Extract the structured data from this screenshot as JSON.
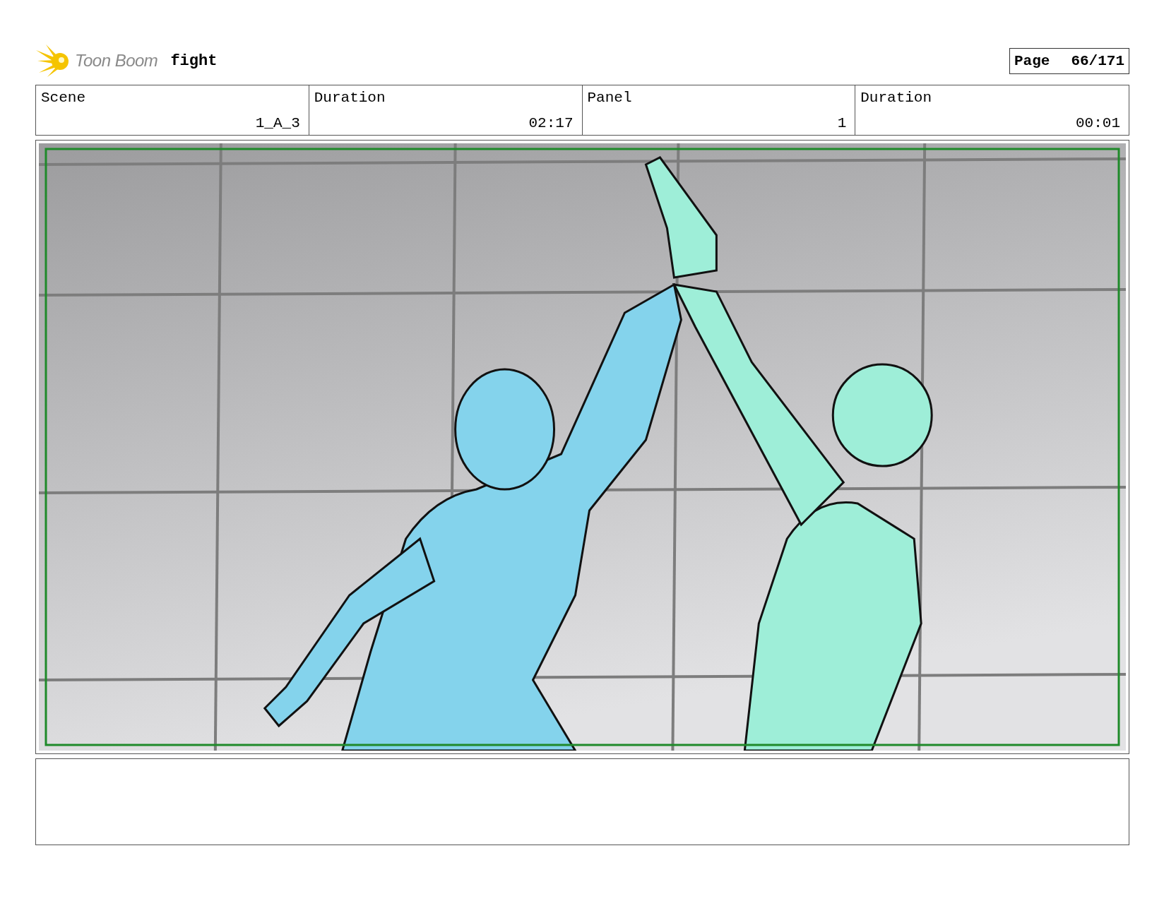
{
  "header": {
    "logo": "Toon Boom",
    "title": "fight",
    "page_label": "Page",
    "page_number": "66/171"
  },
  "info": [
    {
      "label": "Scene",
      "value": "1_A_3"
    },
    {
      "label": "Duration",
      "value": "02:17"
    },
    {
      "label": "Panel",
      "value": "1"
    },
    {
      "label": "Duration",
      "value": "00:01"
    }
  ],
  "panel": {
    "kind": "figure-picture"
  }
}
